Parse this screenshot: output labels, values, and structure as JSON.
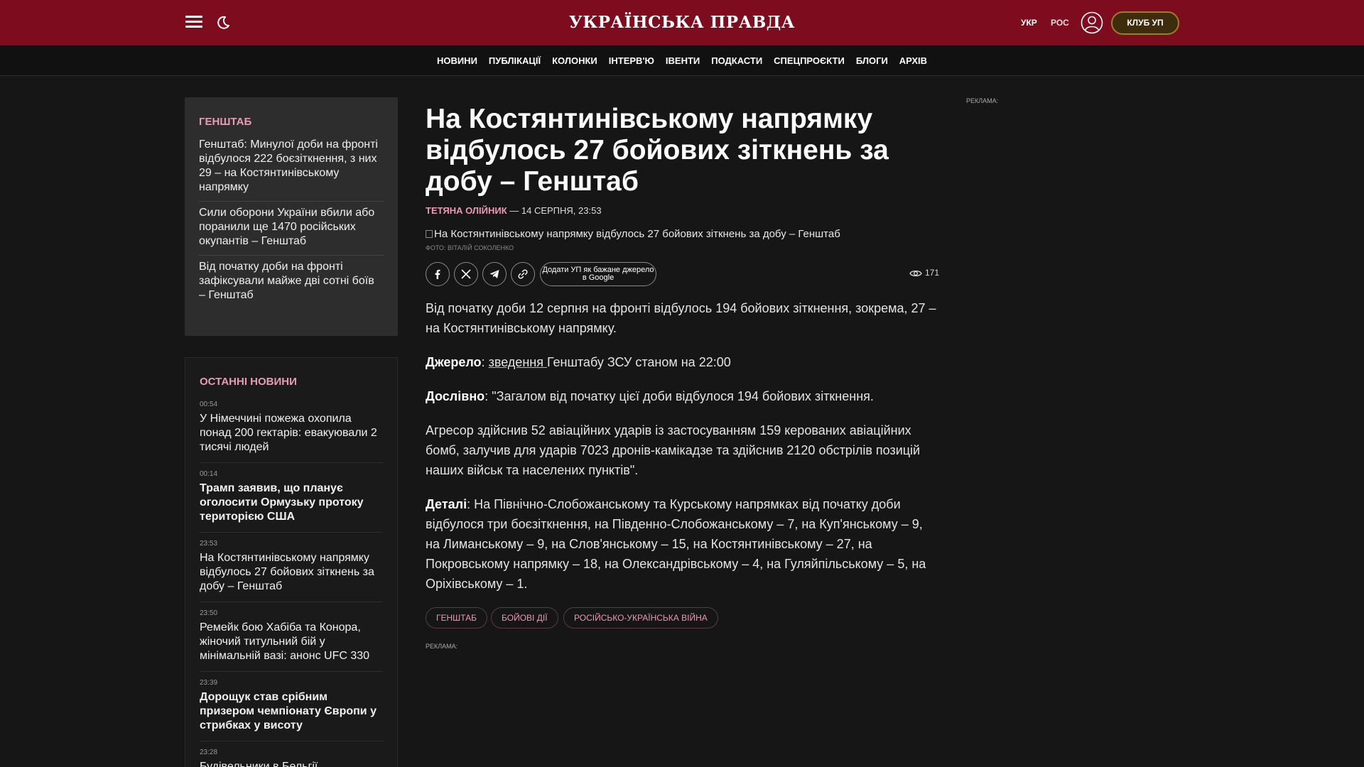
{
  "header": {
    "logo": "УКРАЇНСЬКА ПРАВДА",
    "lang_ukr": "УКР",
    "lang_ros": "РОС",
    "club_button": "КЛУБ УП",
    "icons": [
      "menu-icon",
      "moon-icon",
      "user-icon"
    ],
    "brand_color": "#7d0c1f"
  },
  "nav": {
    "items": [
      "НОВИНИ",
      "ПУБЛІКАЦІЇ",
      "КОЛОНКИ",
      "ІНТЕРВ'Ю",
      "ІВЕНТИ",
      "ПОДКАСТИ",
      "СПЕЦПРОЄКТИ",
      "БЛОГИ",
      "АРХІВ"
    ]
  },
  "related": {
    "title": "ГЕНШТАБ",
    "items": [
      "Генштаб: Минулої доби на фронті відбулося 222 боєзіткнення, з них 29 – на Костянтинівському напрямку",
      "Сили оборони України вбили або поранили ще 1470 російських окупантів – Генштаб",
      "Від початку доби на фронті зафіксували майже дві сотні боїв – Генштаб"
    ]
  },
  "latest": {
    "title": "ОСТАННІ НОВИНИ",
    "items": [
      {
        "time": "00:54",
        "title": "У Німеччині пожежа охопила понад 200 гектарів: евакуювали 2 тисячі людей",
        "bold": false
      },
      {
        "time": "00:14",
        "title": "Трамп заявив, що планує оголосити Ормузьку протоку територією США",
        "bold": true
      },
      {
        "time": "23:53",
        "title": "На Костянтинівському напрямку відбулось 27 бойових зіткнень за добу – Генштаб",
        "bold": false
      },
      {
        "time": "23:50",
        "title": "Ремейк бою Хабіба та Конора, жіночий титульний бій у мінімальній вазі: анонс UFC 330",
        "bold": false
      },
      {
        "time": "23:39",
        "title": "Дорощук став срібним призером чемпіонату Європи у стрибках у висоту",
        "bold": true
      },
      {
        "time": "23:28",
        "title": "Будівельники в Бельгії",
        "bold": false
      }
    ]
  },
  "article": {
    "headline": "На Костянтинівському напрямку відбулось 27 бойових зіткнень за добу – Генштаб",
    "author": "ТЕТЯНА ОЛІЙНИК",
    "date": " — 14 СЕРПНЯ, 23:53",
    "image_alt": "На Костянтинівському напрямку відбулось 27 бойових зіткнень за добу – Генштаб",
    "photo_credit": "Фото: Віталій Соколенко",
    "google_button": "Додати УП як бажане джерело в Google",
    "views": "171",
    "share_icons": [
      "facebook-icon",
      "x-icon",
      "telegram-icon",
      "link-icon"
    ],
    "p1": "Від початку доби 12 серпня на фронті відбулось 194 бойових зіткнення, зокрема, 27 – на Костянтинівському напрямку.",
    "p2_label": "Джерело",
    "p2_sep": ": ",
    "p2_link": "зведення ",
    "p2_rest": "Генштабу ЗСУ станом на 22:00",
    "p3_label": "Дослівно",
    "p3_text": ": \"Загалом від початку цієї доби відбулося 194 бойових зіткнення.",
    "p4": "Агресор здійснив 52 авіаційних ударів із застосуванням 159 керованих авіаційних бомб, залучив для ударів 7023 дронів-камікадзе та здійснив 2120 обстрілів позицій наших військ та населених пунктів\".",
    "p5_label": "Деталі",
    "p5_text": ": На Північно-Слобожанському та Курському напрямках від початку доби відбулося три боєзіткнення, на Південно-Слобожанському – 7, на Куп'янському – 9, на Лиманському – 9, на Слов'янському – 15, на Костянтинівському – 27, на Покровському напрямку – 18, на Олександрівському – 4, на Гуляйпільському – 5, на Оріхівському – 1.",
    "tags": [
      "ГЕНШТАБ",
      "БОЙОВІ ДІЇ",
      "РОСІЙСЬКО-УКРАЇНСЬКА ВІЙНА"
    ],
    "ad_label": "РЕКЛАМА:"
  },
  "right_ad_label": "РЕКЛАМА:"
}
